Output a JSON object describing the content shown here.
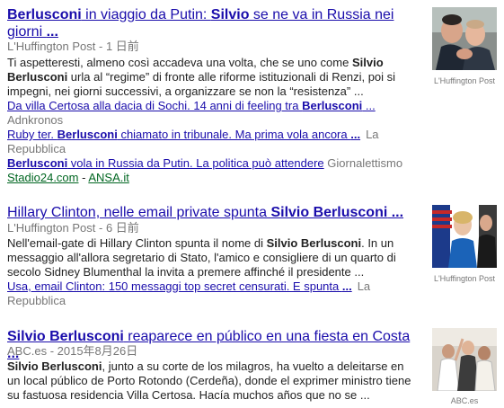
{
  "results": [
    {
      "title_parts": [
        {
          "text": "Berlusconi",
          "bold": true
        },
        {
          "text": " in viaggio da Putin: ",
          "bold": false
        },
        {
          "text": "Silvio",
          "bold": true
        },
        {
          "text": " se ne va in Russia nei giorni ",
          "bold": false
        },
        {
          "text": "...",
          "bold": true
        }
      ],
      "source": "L'Huffington Post",
      "date": "1 日前",
      "snippet_parts": [
        {
          "text": "Ti aspetteresti, almeno così accadeva una volta, che se uno come ",
          "bold": false
        },
        {
          "text": "Silvio Berlusconi",
          "bold": true
        },
        {
          "text": " urla al “regime” di fronte alle riforme istituzionali di Renzi, poi si impegni, nei giorni successivi, a organizzare se non la “resistenza” ...",
          "bold": false
        }
      ],
      "related": [
        {
          "parts": [
            {
              "text": "Da villa Certosa alla dacia di Sochi. 14 anni di feeling tra ",
              "bold": false
            },
            {
              "text": "Berlusconi",
              "bold": true
            },
            {
              "text": " ...",
              "bold": false
            }
          ],
          "publisher": "Adnkronos"
        },
        {
          "parts": [
            {
              "text": "Ruby ter. ",
              "bold": false
            },
            {
              "text": "Berlusconi",
              "bold": true
            },
            {
              "text": " chiamato in tribunale. Ma prima vola ancora ",
              "bold": false
            },
            {
              "text": "...",
              "bold": true
            }
          ],
          "publisher": "La Repubblica"
        },
        {
          "parts": [
            {
              "text": "Berlusconi",
              "bold": true
            },
            {
              "text": " vola in Russia da Putin. La politica può attendere",
              "bold": false
            }
          ],
          "publisher": "Giornalettismo"
        }
      ],
      "more_sources": [
        "Stadio24.com",
        "ANSA.it"
      ],
      "image_caption": "L'Huffington Post"
    },
    {
      "title_parts": [
        {
          "text": "Hillary Clinton, nelle email private spunta ",
          "bold": false
        },
        {
          "text": "Silvio Berlusconi",
          "bold": true
        },
        {
          "text": " ...",
          "bold": true
        }
      ],
      "source": "L'Huffington Post",
      "date": "6 日前",
      "snippet_parts": [
        {
          "text": "Nell'email-gate di Hillary Clinton spunta il nome di ",
          "bold": false
        },
        {
          "text": "Silvio Berlusconi",
          "bold": true
        },
        {
          "text": ". In un messaggio all'allora segretario di Stato, l'amico e consigliere di un quarto di secolo Sidney Blumenthal la invita a premere affinché il presidente ...",
          "bold": false
        }
      ],
      "related": [
        {
          "parts": [
            {
              "text": "Usa, email Clinton: 150 messaggi top secret censurati. E spunta ",
              "bold": false
            },
            {
              "text": "...",
              "bold": true
            }
          ],
          "publisher": "La Repubblica"
        }
      ],
      "image_caption": "L'Huffington Post"
    },
    {
      "title_parts": [
        {
          "text": "Silvio Berlusconi",
          "bold": true
        },
        {
          "text": " reaparece en público en una fiesta en Costa ",
          "bold": false
        },
        {
          "text": "...",
          "bold": true
        }
      ],
      "source": "ABC.es",
      "date": "2015年8月26日",
      "snippet_parts": [
        {
          "text": "Silvio Berlusconi",
          "bold": true
        },
        {
          "text": ", junto a su corte de los milagros, ha vuelto a deleitarse en un local público de Porto Rotondo (Cerdeña), donde el exprimer ministro tiene su fastuosa residencia Villa Certosa. Hacía muchos años que no se ...",
          "bold": false
        }
      ],
      "related": [],
      "image_caption": "ABC.es"
    }
  ],
  "separator": " - ",
  "colors": {
    "link": "#1a0dab",
    "source": "#777777",
    "green": "#006621"
  }
}
